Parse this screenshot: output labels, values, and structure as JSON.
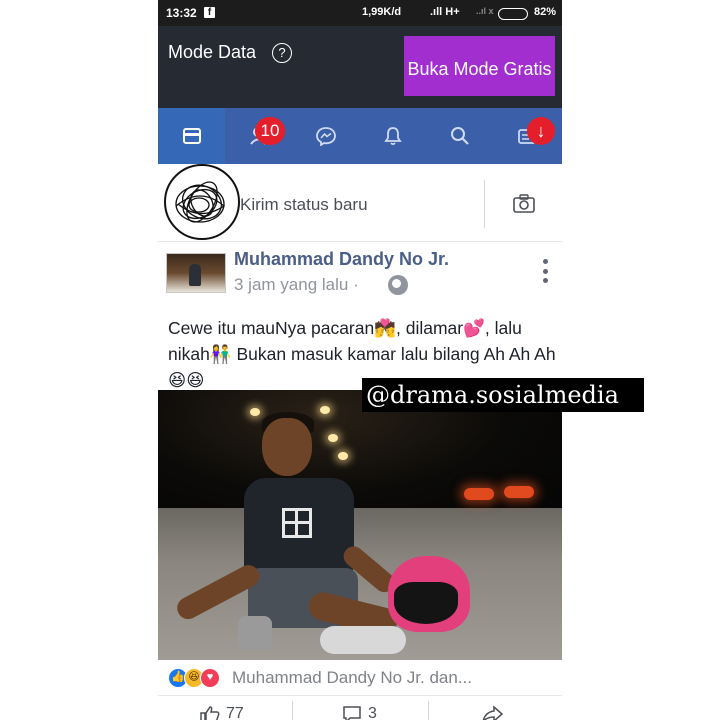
{
  "status_bar": {
    "time": "13:32",
    "fb_glyph": "f",
    "net_speed": "1,99K/d",
    "signal": ".ıll H+",
    "signal2": "..ıl x",
    "battery_level": 82,
    "battery_percent": "82%"
  },
  "data_mode": {
    "label": "Mode Data",
    "help_glyph": "?",
    "button_label": "Buka Mode Gratis",
    "button_color": "#a22ecf"
  },
  "nav": {
    "bar_color": "#3b5fa8",
    "tabs": [
      {
        "name": "feed",
        "icon": "news-feed-icon",
        "active": true
      },
      {
        "name": "friends",
        "icon": "friends-icon",
        "badge": "10"
      },
      {
        "name": "messenger",
        "icon": "messenger-icon"
      },
      {
        "name": "notifications",
        "icon": "bell-icon"
      },
      {
        "name": "search",
        "icon": "search-icon"
      },
      {
        "name": "menu",
        "icon": "menu-icon",
        "badge_glyph": "↓"
      }
    ]
  },
  "composer": {
    "placeholder": "Kirim status baru",
    "camera_icon": "camera-icon"
  },
  "post": {
    "author": "Muhammad Dandy No Jr.",
    "time": "3 jam yang lalu",
    "separator": "·",
    "privacy_icon": "globe-icon",
    "text": "Cewe itu mauNya pacaran💏, dilamar💕, lalu nikah👫 Bukan masuk kamar lalu bilang Ah Ah Ah😆😆",
    "watermark": "@drama.sosialmedia",
    "reactions": {
      "icons": [
        "like-icon",
        "haha-icon",
        "love-icon"
      ],
      "summary": "Muhammad Dandy No Jr. dan..."
    },
    "actions": {
      "like_count": "77",
      "comment_count": "3"
    }
  }
}
